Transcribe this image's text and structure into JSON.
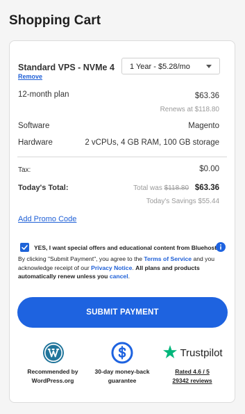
{
  "page": {
    "title": "Shopping Cart"
  },
  "cart": {
    "product_name": "Standard VPS - NVMe 4",
    "remove_label": "Remove",
    "term_selected": "1 Year - $5.28/mo",
    "plan_label": "12-month plan",
    "plan_price": "$63.36",
    "renews_text": "Renews at $118.80",
    "software_label": "Software",
    "software_value": "Magento",
    "hardware_label": "Hardware",
    "hardware_value": "2 vCPUs, 4 GB RAM, 100 GB storage"
  },
  "totals": {
    "tax_label": "Tax:",
    "tax_value": "$0.00",
    "total_label": "Today's Total:",
    "was_prefix": "Total was",
    "was_value": "$118.80",
    "total_value": "$63.36",
    "savings_text": "Today's Savings $55.44"
  },
  "promo": {
    "label": "Add Promo Code"
  },
  "optin": {
    "checked": true,
    "label": "YES, I want special offers and educational content from Bluehost."
  },
  "terms": {
    "part1": "By clicking \"Submit Payment\", you agree to the",
    "tos_link": "Terms of Service",
    "part2": "and you acknowledge receipt of our",
    "privacy_link": "Privacy Notice",
    "part3": ".",
    "bold_text": "All plans and products automatically renew unless you",
    "cancel_link": "cancel",
    "part4": "."
  },
  "submit": {
    "label": "SUBMIT PAYMENT"
  },
  "badges": {
    "wordpress_line1": "Recommended by",
    "wordpress_line2": "WordPress.org",
    "guarantee_line1": "30-day money-back",
    "guarantee_line2": "guarantee",
    "trustpilot_name": "Trustpilot",
    "trustpilot_rating": "Rated 4.6 / 5",
    "trustpilot_reviews": "29342 reviews"
  },
  "colors": {
    "accent": "#1e63e0",
    "link": "#1e5fd6",
    "trustpilot_green": "#00b67a"
  }
}
